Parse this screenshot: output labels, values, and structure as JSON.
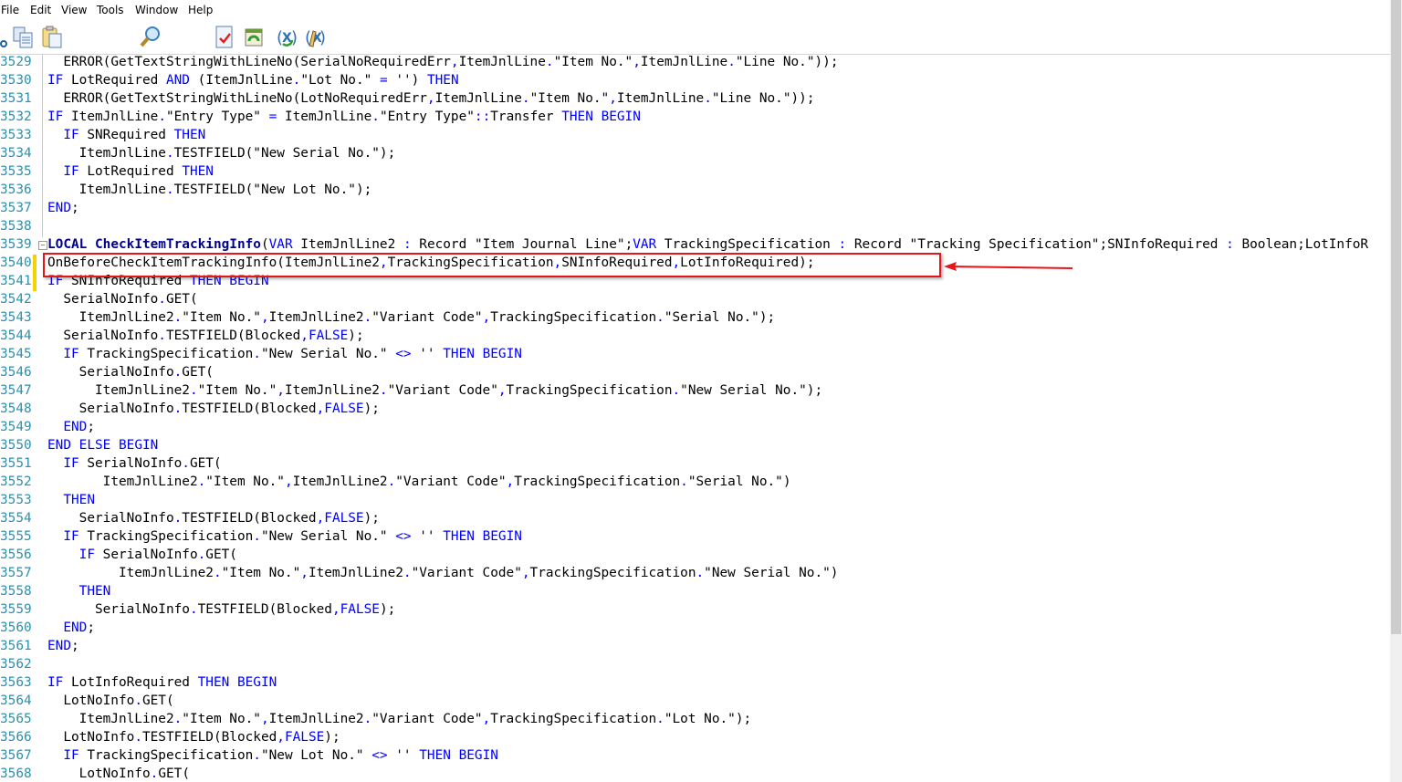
{
  "menu": [
    "File",
    "Edit",
    "View",
    "Tools",
    "Window",
    "Help"
  ],
  "toolbar": {
    "icons": [
      "cut-icon",
      "copy-icon",
      "paste-icon",
      "find-icon",
      "check-icon",
      "compile-icon",
      "symbol-refresh-icon",
      "symbol-edit-icon"
    ]
  },
  "colors": {
    "keyword": "#0000ff",
    "line_number": "#2b91af",
    "annotation": "#e8141b",
    "change_bar": "#f5d300"
  },
  "editor": {
    "bold_words": [
      "LOCAL",
      "CheckItemTrackingInfo"
    ],
    "keywords": [
      "IF",
      "THEN",
      "BEGIN",
      "END",
      "ELSE",
      "AND",
      "VAR",
      "FALSE",
      "LOCAL"
    ],
    "changed_lines": [
      "3540",
      "3541"
    ],
    "fold_line": "3539",
    "highlighted_line": "3540",
    "lines": [
      {
        "n": "3529",
        "t": "  ERROR(GetTextStringWithLineNo(SerialNoRequiredErr,ItemJnlLine.\"Item No.\",ItemJnlLine.\"Line No.\"));"
      },
      {
        "n": "3530",
        "t": "IF LotRequired AND (ItemJnlLine.\"Lot No.\" = '') THEN"
      },
      {
        "n": "3531",
        "t": "  ERROR(GetTextStringWithLineNo(LotNoRequiredErr,ItemJnlLine.\"Item No.\",ItemJnlLine.\"Line No.\"));"
      },
      {
        "n": "3532",
        "t": "IF ItemJnlLine.\"Entry Type\" = ItemJnlLine.\"Entry Type\"::Transfer THEN BEGIN"
      },
      {
        "n": "3533",
        "t": "  IF SNRequired THEN"
      },
      {
        "n": "3534",
        "t": "    ItemJnlLine.TESTFIELD(\"New Serial No.\");"
      },
      {
        "n": "3535",
        "t": "  IF LotRequired THEN"
      },
      {
        "n": "3536",
        "t": "    ItemJnlLine.TESTFIELD(\"New Lot No.\");"
      },
      {
        "n": "3537",
        "t": "END;"
      },
      {
        "n": "3538",
        "t": ""
      },
      {
        "n": "3539",
        "t": "LOCAL CheckItemTrackingInfo(VAR ItemJnlLine2 : Record \"Item Journal Line\";VAR TrackingSpecification : Record \"Tracking Specification\";SNInfoRequired : Boolean;LotInfoR"
      },
      {
        "n": "3540",
        "t": "OnBeforeCheckItemTrackingInfo(ItemJnlLine2,TrackingSpecification,SNInfoRequired,LotInfoRequired);"
      },
      {
        "n": "3541",
        "t": "IF SNInfoRequired THEN BEGIN"
      },
      {
        "n": "3542",
        "t": "  SerialNoInfo.GET("
      },
      {
        "n": "3543",
        "t": "    ItemJnlLine2.\"Item No.\",ItemJnlLine2.\"Variant Code\",TrackingSpecification.\"Serial No.\");"
      },
      {
        "n": "3544",
        "t": "  SerialNoInfo.TESTFIELD(Blocked,FALSE);"
      },
      {
        "n": "3545",
        "t": "  IF TrackingSpecification.\"New Serial No.\" <> '' THEN BEGIN"
      },
      {
        "n": "3546",
        "t": "    SerialNoInfo.GET("
      },
      {
        "n": "3547",
        "t": "      ItemJnlLine2.\"Item No.\",ItemJnlLine2.\"Variant Code\",TrackingSpecification.\"New Serial No.\");"
      },
      {
        "n": "3548",
        "t": "    SerialNoInfo.TESTFIELD(Blocked,FALSE);"
      },
      {
        "n": "3549",
        "t": "  END;"
      },
      {
        "n": "3550",
        "t": "END ELSE BEGIN"
      },
      {
        "n": "3551",
        "t": "  IF SerialNoInfo.GET("
      },
      {
        "n": "3552",
        "t": "       ItemJnlLine2.\"Item No.\",ItemJnlLine2.\"Variant Code\",TrackingSpecification.\"Serial No.\")"
      },
      {
        "n": "3553",
        "t": "  THEN"
      },
      {
        "n": "3554",
        "t": "    SerialNoInfo.TESTFIELD(Blocked,FALSE);"
      },
      {
        "n": "3555",
        "t": "  IF TrackingSpecification.\"New Serial No.\" <> '' THEN BEGIN"
      },
      {
        "n": "3556",
        "t": "    IF SerialNoInfo.GET("
      },
      {
        "n": "3557",
        "t": "         ItemJnlLine2.\"Item No.\",ItemJnlLine2.\"Variant Code\",TrackingSpecification.\"New Serial No.\")"
      },
      {
        "n": "3558",
        "t": "    THEN"
      },
      {
        "n": "3559",
        "t": "      SerialNoInfo.TESTFIELD(Blocked,FALSE);"
      },
      {
        "n": "3560",
        "t": "  END;"
      },
      {
        "n": "3561",
        "t": "END;"
      },
      {
        "n": "3562",
        "t": ""
      },
      {
        "n": "3563",
        "t": "IF LotInfoRequired THEN BEGIN"
      },
      {
        "n": "3564",
        "t": "  LotNoInfo.GET("
      },
      {
        "n": "3565",
        "t": "    ItemJnlLine2.\"Item No.\",ItemJnlLine2.\"Variant Code\",TrackingSpecification.\"Lot No.\");"
      },
      {
        "n": "3566",
        "t": "  LotNoInfo.TESTFIELD(Blocked,FALSE);"
      },
      {
        "n": "3567",
        "t": "  IF TrackingSpecification.\"New Lot No.\" <> '' THEN BEGIN"
      },
      {
        "n": "3568",
        "t": "    LotNoInfo.GET("
      }
    ]
  }
}
